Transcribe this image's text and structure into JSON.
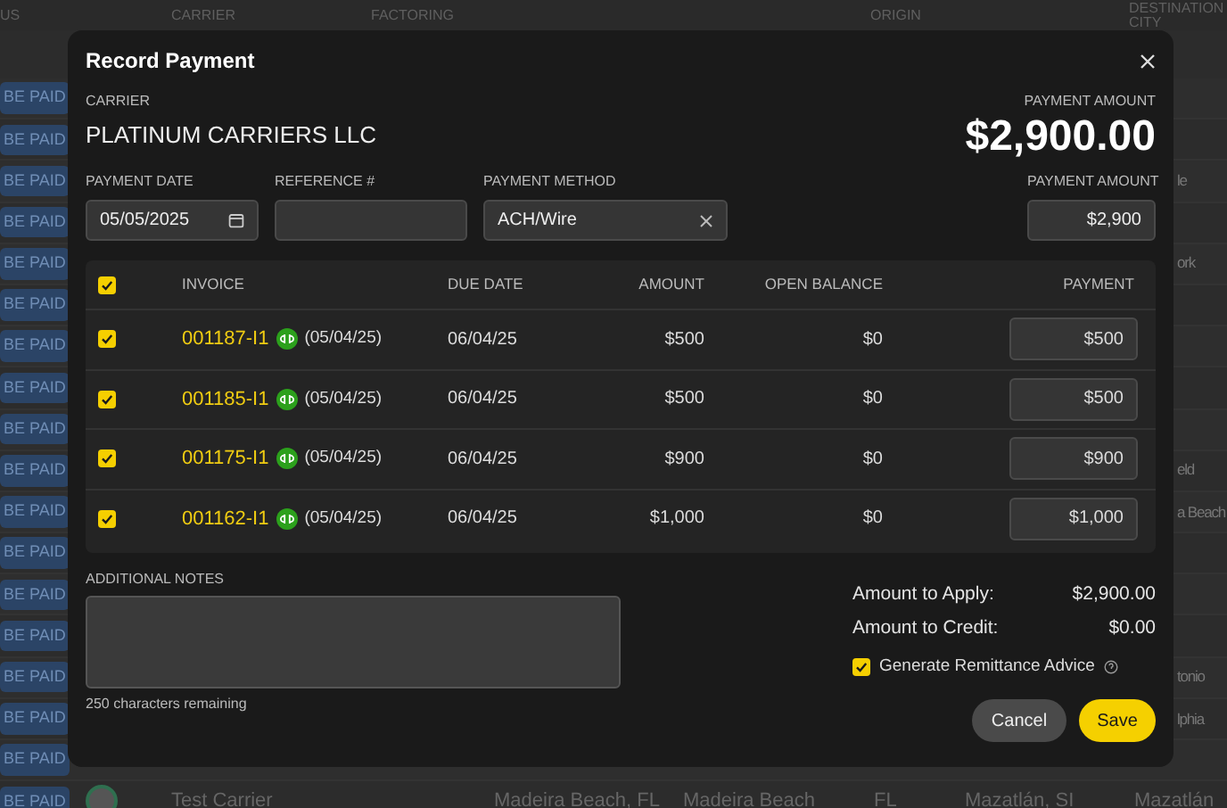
{
  "background": {
    "columns": [
      {
        "label": "US"
      },
      {
        "label": "CARRIER"
      },
      {
        "label": "FACTORING"
      },
      {
        "label": "ORIGIN"
      },
      {
        "label": "DESTINATION CITY"
      }
    ],
    "rows": [
      {
        "kind": "status",
        "status": "BE PAID"
      },
      {
        "kind": "status",
        "status": "BE PAID"
      },
      {
        "kind": "status",
        "status": "BE PAID",
        "destination": "le"
      },
      {
        "kind": "status",
        "status": "BE PAID"
      },
      {
        "kind": "status",
        "status": "BE PAID",
        "destination": "ork"
      },
      {
        "kind": "status",
        "status": "BE PAID"
      },
      {
        "kind": "status",
        "status": "BE PAID"
      },
      {
        "kind": "status",
        "status": "BE PAID"
      },
      {
        "kind": "status",
        "status": "BE PAID"
      },
      {
        "kind": "status",
        "status": "BE PAID",
        "destination": "eld"
      },
      {
        "kind": "status",
        "status": "BE PAID",
        "destination": "a Beach"
      },
      {
        "kind": "status",
        "status": "BE PAID"
      },
      {
        "kind": "status",
        "status": "BE PAID"
      },
      {
        "kind": "status",
        "status": "BE PAID"
      },
      {
        "kind": "status",
        "status": "BE PAID",
        "destination": "tonio"
      },
      {
        "kind": "status",
        "status": "BE PAID",
        "destination": "lphia"
      },
      {
        "kind": "status",
        "status": "BE PAID"
      },
      {
        "kind": "carrier",
        "status": "BE PAID",
        "carrier": "Test Carrier",
        "origin": "Madeira Beach, FL",
        "origin_city": "Madeira Beach",
        "origin_state": "FL",
        "destination_full": "Mazatlán, SI",
        "destination": "Mazatlán"
      }
    ]
  },
  "modal": {
    "title": "Record Payment",
    "carrier_label": "CARRIER",
    "carrier": "PLATINUM CARRIERS LLC",
    "amount_label": "PAYMENT AMOUNT",
    "amount": "$2,900.00",
    "fields": [
      {
        "kind": "date",
        "label": "PAYMENT DATE",
        "value": "05/05/2025"
      },
      {
        "kind": "text",
        "label": "REFERENCE #"
      },
      {
        "kind": "select",
        "label": "PAYMENT METHOD",
        "value": "ACH/Wire"
      },
      {
        "kind": "amount",
        "label": "PAYMENT AMOUNT",
        "value": "$2,900"
      }
    ],
    "invoices": {
      "all_checked": true,
      "columns": [
        "INVOICE",
        "DUE DATE",
        "AMOUNT",
        "OPEN BALANCE",
        "PAYMENT"
      ],
      "rows": [
        {
          "checked": true,
          "invoice": "001187-I1",
          "date": "(05/04/25)",
          "due": "06/04/25",
          "amount": "$500",
          "open_balance": "$0",
          "payment": "$500"
        },
        {
          "checked": true,
          "invoice": "001185-I1",
          "date": "(05/04/25)",
          "due": "06/04/25",
          "amount": "$500",
          "open_balance": "$0",
          "payment": "$500"
        },
        {
          "checked": true,
          "invoice": "001175-I1",
          "date": "(05/04/25)",
          "due": "06/04/25",
          "amount": "$900",
          "open_balance": "$0",
          "payment": "$900"
        },
        {
          "checked": true,
          "invoice": "001162-I1",
          "date": "(05/04/25)",
          "due": "06/04/25",
          "amount": "$1,000",
          "open_balance": "$0",
          "payment": "$1,000"
        }
      ]
    },
    "notes": {
      "label": "ADDITIONAL NOTES",
      "hint": "250 characters remaining"
    },
    "summary": [
      {
        "label": "Amount to Apply:",
        "value": "$2,900.00"
      },
      {
        "label": "Amount to Credit:",
        "value": "$0.00"
      }
    ],
    "remittance": {
      "label": "Generate Remittance Advice",
      "checked": true
    },
    "buttons": [
      {
        "kind": "secondary",
        "label": "Cancel"
      },
      {
        "kind": "primary",
        "label": "Save"
      }
    ]
  }
}
